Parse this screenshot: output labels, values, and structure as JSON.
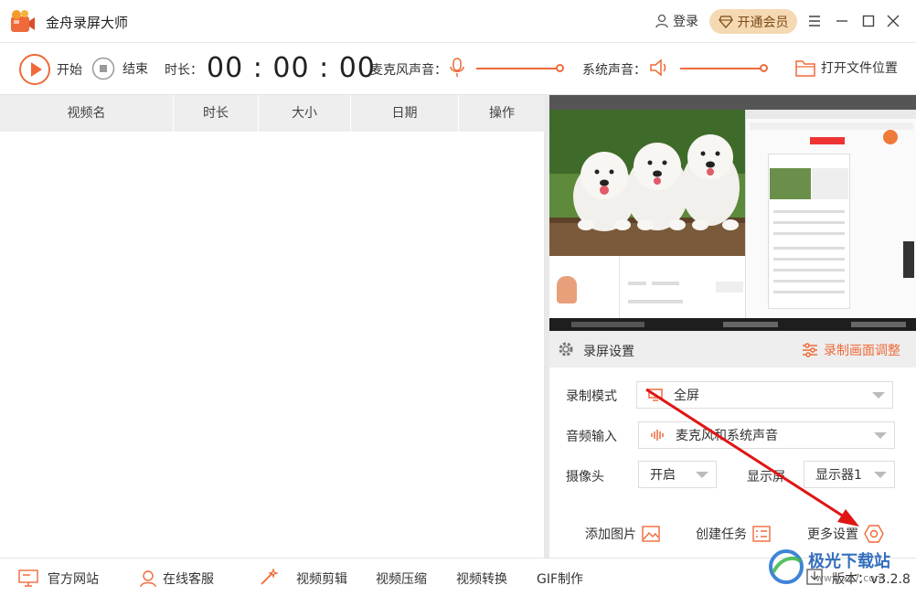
{
  "titlebar": {
    "app_title": "金舟录屏大师",
    "login_label": "登录",
    "vip_label": "开通会员",
    "brand_color": "#ef6a3a"
  },
  "toolbar": {
    "start_label": "开始",
    "stop_label": "结束",
    "duration_label": "时长：",
    "timer": "00 : 00 : 00",
    "mic_label": "麦克风声音：",
    "system_label": "系统声音：",
    "open_folder_label": "打开文件位置"
  },
  "table": {
    "columns": [
      "视频名",
      "时长",
      "大小",
      "日期",
      "操作"
    ]
  },
  "settings": {
    "header_label": "录屏设置",
    "adjust_label": "录制画面调整",
    "mode_label": "录制模式",
    "mode_value": "全屏",
    "audio_label": "音频输入",
    "audio_value": "麦克风和系统声音",
    "camera_label": "摄像头",
    "camera_value": "开启",
    "display_label": "显示屏",
    "display_value": "显示器1",
    "add_image_label": "添加图片",
    "create_task_label": "创建任务",
    "more_settings_label": "更多设置"
  },
  "bottombar": {
    "website_label": "官方网站",
    "service_label": "在线客服",
    "edit_label": "视频剪辑",
    "compress_label": "视频压缩",
    "convert_label": "视频转换",
    "gif_label": "GIF制作",
    "version_label": "版本：v3.2.8"
  },
  "watermark": {
    "text": "极光下载站",
    "url": "www.xz7.com"
  }
}
